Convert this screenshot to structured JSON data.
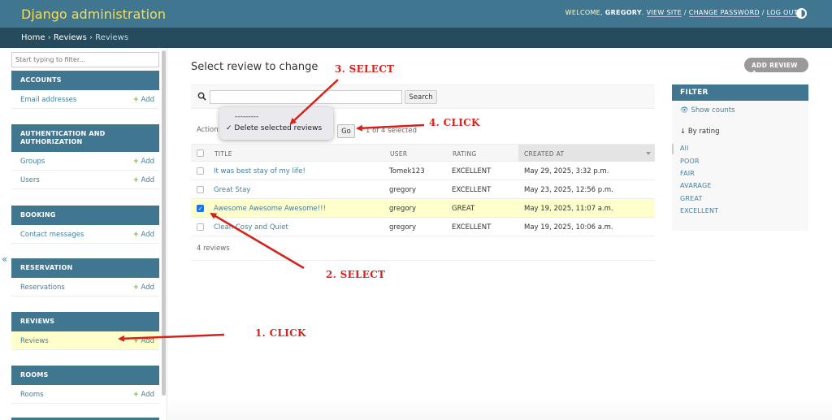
{
  "header": {
    "brand": "Django administration",
    "welcome": "WELCOME,",
    "user": "GREGORY",
    "view_site": "VIEW SITE",
    "change_password": "CHANGE PASSWORD",
    "logout": "LOG OUT",
    "sep": "/"
  },
  "breadcrumbs": {
    "home": "Home",
    "sep": "›",
    "app": "Reviews",
    "current": "Reviews"
  },
  "sidebar": {
    "filter_placeholder": "Start typing to filter...",
    "collapse": "«",
    "add_label": "Add",
    "modules": [
      {
        "caption": "ACCOUNTS",
        "items": [
          "Email addresses"
        ]
      },
      {
        "caption": "AUTHENTICATION AND AUTHORIZATION",
        "items": [
          "Groups",
          "Users"
        ]
      },
      {
        "caption": "BOOKING",
        "items": [
          "Contact messages"
        ]
      },
      {
        "caption": "RESERVATION",
        "items": [
          "Reservations"
        ]
      },
      {
        "caption": "REVIEWS",
        "items": [
          "Reviews"
        ]
      },
      {
        "caption": "ROOMS",
        "items": [
          "Rooms"
        ]
      }
    ]
  },
  "main": {
    "title": "Select review to change",
    "add_button": "ADD REVIEW",
    "search_button": "Search",
    "action_label": "Action:",
    "dropdown_options": [
      "---------",
      "✓ Delete selected reviews"
    ],
    "go_button": "Go",
    "selected_count": "1 of 4 selected",
    "columns": [
      "TITLE",
      "USER",
      "RATING",
      "CREATED AT"
    ],
    "rows": [
      {
        "title": "It was best stay of my life!",
        "user": "Tomek123",
        "rating": "EXCELLENT",
        "created": "May 29, 2025, 3:32 p.m.",
        "checked": false
      },
      {
        "title": "Great Stay",
        "user": "gregory",
        "rating": "EXCELLENT",
        "created": "May 23, 2025, 12:56 p.m.",
        "checked": false
      },
      {
        "title": "Awesome Awesome Awesome!!!",
        "user": "gregory",
        "rating": "GREAT",
        "created": "May 19, 2025, 11:07 a.m.",
        "checked": true
      },
      {
        "title": "Clean Cosy and Quiet",
        "user": "gregory",
        "rating": "EXCELLENT",
        "created": "May 19, 2025, 10:06 a.m.",
        "checked": false
      }
    ],
    "paginator": "4 reviews"
  },
  "filter": {
    "caption": "FILTER",
    "show_counts": "Show counts",
    "by_rating": "By rating",
    "options": [
      "All",
      "POOR",
      "FAIR",
      "AVARAGE",
      "GREAT",
      "EXCELLENT"
    ]
  },
  "annotations": {
    "step1": "1. CLICK",
    "step2": "2. SELECT",
    "step3": "3. SELECT",
    "step4": "4. CLICK",
    "color": "#d8211b"
  },
  "colors": {
    "header": "#417690",
    "breadcrumbs": "#264b5d",
    "brand": "#f5dd5d",
    "link": "#447e9b",
    "selected_row": "#ffffcc"
  }
}
